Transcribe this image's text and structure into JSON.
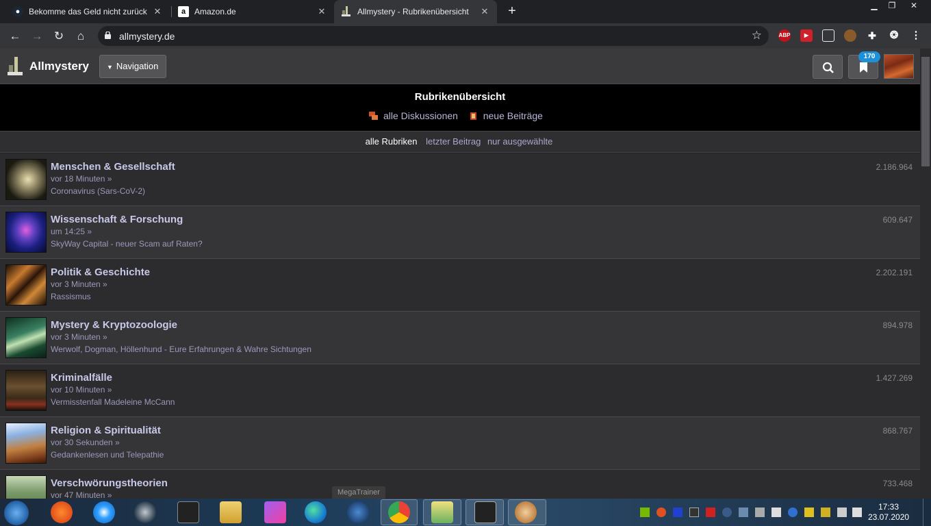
{
  "browser": {
    "tabs": [
      {
        "title": "Bekomme das Geld nicht zurück",
        "icon": "steam-icon"
      },
      {
        "title": "Amazon.de",
        "icon": "amazon-icon"
      },
      {
        "title": "Allmystery - Rubrikenübersicht",
        "icon": "allmystery-icon"
      }
    ],
    "url": "allmystery.de",
    "extensions": {
      "abp": "ABP"
    }
  },
  "site": {
    "name": "Allmystery",
    "nav_label": "Navigation",
    "bookmark_count": "170"
  },
  "banner": {
    "title": "Rubrikenübersicht",
    "links": [
      "alle Diskussionen",
      "neue Beiträge"
    ]
  },
  "filters": {
    "active": "alle Rubriken",
    "options": [
      "letzter Beitrag",
      "nur ausgewählte"
    ]
  },
  "categories": [
    {
      "title": "Menschen & Gesellschaft",
      "time": "vor 18 Minuten",
      "topic": "Coronavirus (Sars-CoV-2)",
      "count": "2.186.964"
    },
    {
      "title": "Wissenschaft & Forschung",
      "time": "um 14:25",
      "topic": "SkyWay Capital - neuer Scam auf Raten?",
      "count": "609.647"
    },
    {
      "title": "Politik & Geschichte",
      "time": "vor 3 Minuten",
      "topic": "Rassismus",
      "count": "2.202.191"
    },
    {
      "title": "Mystery & Kryptozoologie",
      "time": "vor 3 Minuten",
      "topic": "Werwolf, Dogman, Höllenhund - Eure Erfahrungen & Wahre Sichtungen",
      "count": "894.978"
    },
    {
      "title": "Kriminalfälle",
      "time": "vor 10 Minuten",
      "topic": "Vermisstenfall Madeleine McCann",
      "count": "1.427.269"
    },
    {
      "title": "Religion & Spiritualität",
      "time": "vor 30 Sekunden",
      "topic": "Gedankenlesen und Telepathie",
      "count": "868.767"
    },
    {
      "title": "Verschwörungstheorien",
      "time": "vor 47 Minuten",
      "topic": "",
      "count": "733.468"
    }
  ],
  "more_marker": "»",
  "taskbar": {
    "tooltip": "MegaTrainer",
    "time": "17:33",
    "date": "23.07.2020"
  },
  "colors": {
    "page_bg": "#2c2c2f",
    "accent_badge": "#1e90d8",
    "link": "#c8c8e8"
  }
}
